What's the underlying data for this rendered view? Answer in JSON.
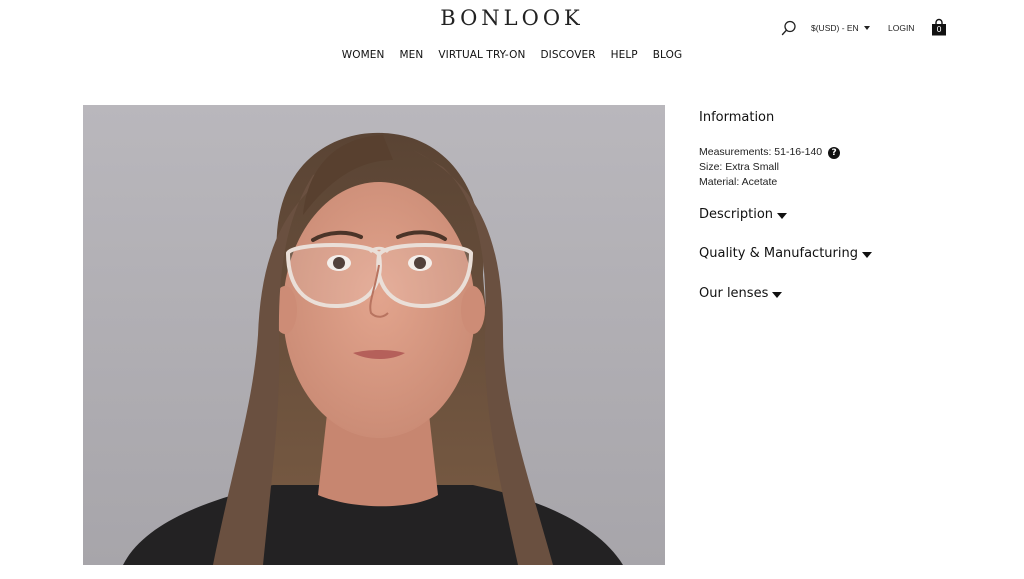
{
  "header": {
    "logo": "BONLOOK",
    "currency": "$(USD) - EN",
    "login": "LOGIN",
    "cart_count": "0"
  },
  "nav": {
    "items": [
      "WOMEN",
      "MEN",
      "VIRTUAL TRY-ON",
      "DISCOVER",
      "HELP",
      "BLOG"
    ]
  },
  "product": {
    "image_alt": ""
  },
  "info": {
    "heading": "Information",
    "measurements": "Measurements: 51-16-140",
    "size": "Size: Extra Small",
    "material": "Material: Acetate",
    "help_glyph": "?"
  },
  "accordions": {
    "description": "Description",
    "quality": "Quality & Manufacturing",
    "lenses": "Our lenses"
  },
  "icons": {
    "search": "search-icon",
    "cart": "shopping-bag-icon",
    "caret": "chevron-down-icon",
    "help": "question-circle-icon"
  },
  "colors": {
    "text": "#111111",
    "photo_background": "#b0aeb3",
    "page_background": "#ffffff"
  }
}
